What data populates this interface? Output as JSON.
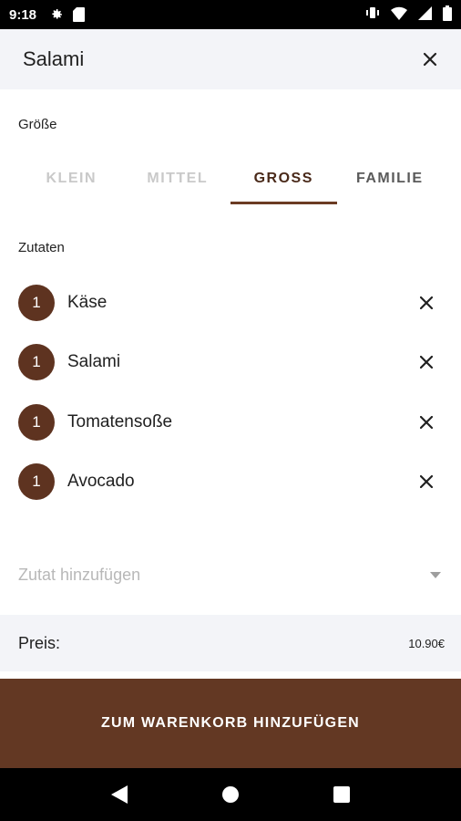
{
  "status_bar": {
    "time": "9:18",
    "icons": [
      "settings-icon",
      "sd-card-icon",
      "vibrate-icon",
      "wifi-icon",
      "signal-icon",
      "battery-icon"
    ]
  },
  "header": {
    "title": "Salami",
    "close_icon": "close-icon"
  },
  "size": {
    "label": "Größe",
    "tabs": [
      {
        "label": "KLEIN",
        "state": "inactive"
      },
      {
        "label": "MITTEL",
        "state": "inactive"
      },
      {
        "label": "GROSS",
        "state": "active"
      },
      {
        "label": "FAMILIE",
        "state": "inactive"
      }
    ]
  },
  "ingredients": {
    "label": "Zutaten",
    "items": [
      {
        "count": "1",
        "name": "Käse"
      },
      {
        "count": "1",
        "name": "Salami"
      },
      {
        "count": "1",
        "name": "Tomatensoße"
      },
      {
        "count": "1",
        "name": "Avocado"
      }
    ]
  },
  "add_ingredient": {
    "placeholder": "Zutat hinzufügen"
  },
  "price": {
    "label": "Preis:",
    "value": "10.90€"
  },
  "cta": {
    "label": "ZUM WARENKORB HINZUFÜGEN"
  },
  "colors": {
    "accent": "#633823",
    "badge": "#5e3320",
    "header_bg": "#f3f4f8"
  }
}
